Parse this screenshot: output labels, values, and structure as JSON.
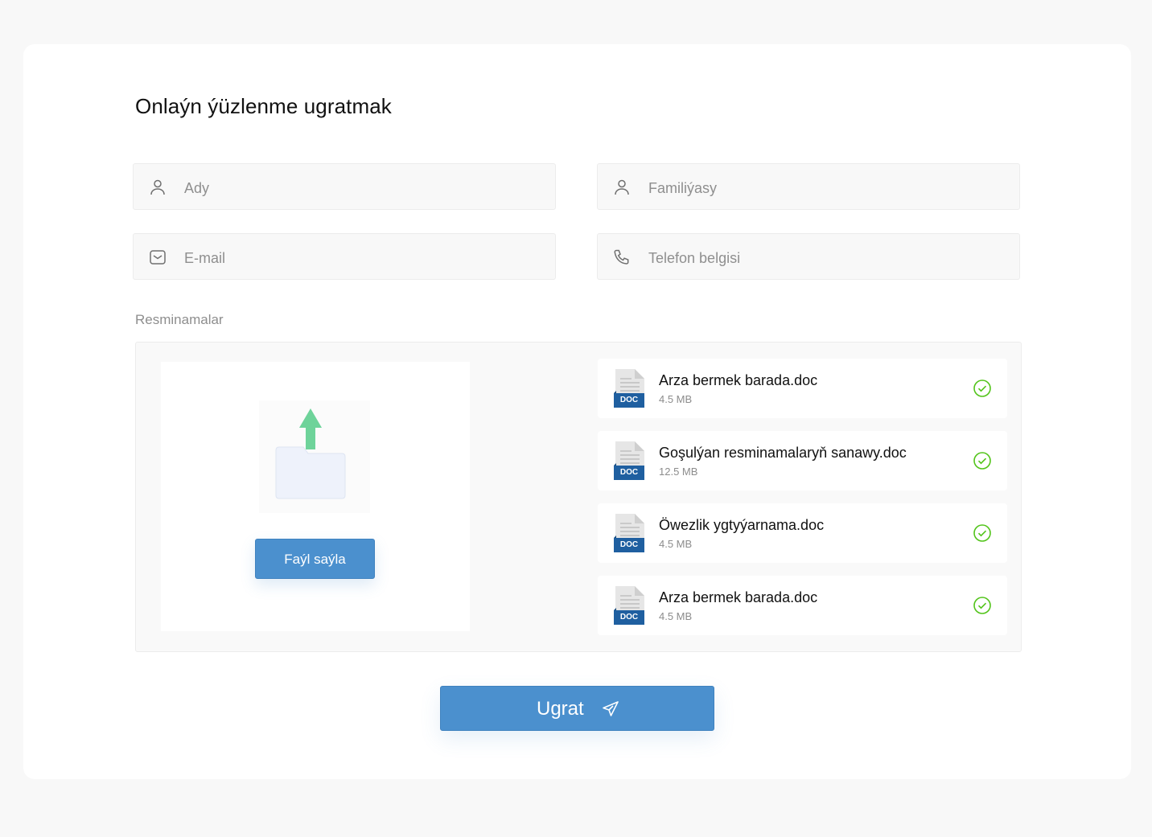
{
  "form": {
    "title": "Onlaýn ýüzlenme ugratmak",
    "fields": {
      "first_name": {
        "placeholder": "Ady",
        "icon": "user-icon"
      },
      "last_name": {
        "placeholder": "Familiýasy",
        "icon": "user-icon"
      },
      "email": {
        "placeholder": "E-mail",
        "icon": "mail-icon"
      },
      "phone": {
        "placeholder": "Telefon belgisi",
        "icon": "phone-icon"
      }
    },
    "documents_label": "Resminamalar",
    "upload": {
      "button_label": "Faýl saýla",
      "icon": "folder-upload-icon"
    },
    "files": [
      {
        "name": "Arza bermek barada.doc",
        "size": "4.5 MB",
        "type_label": "DOC",
        "status": "uploaded"
      },
      {
        "name": "Goşulýan resminamalaryň sanawy.doc",
        "size": "12.5 MB",
        "type_label": "DOC",
        "status": "uploaded"
      },
      {
        "name": "Öwezlik ygtyýarnama.doc",
        "size": "4.5 MB",
        "type_label": "DOC",
        "status": "uploaded"
      },
      {
        "name": "Arza bermek barada.doc",
        "size": "4.5 MB",
        "type_label": "DOC",
        "status": "uploaded"
      }
    ],
    "submit_label": "Ugrat"
  },
  "colors": {
    "primary": "#4b90ce",
    "success": "#52c41a",
    "doc_badge": "#1f5fa0",
    "upload_arrow": "#6ed39a",
    "folder": "#eef2fb"
  }
}
